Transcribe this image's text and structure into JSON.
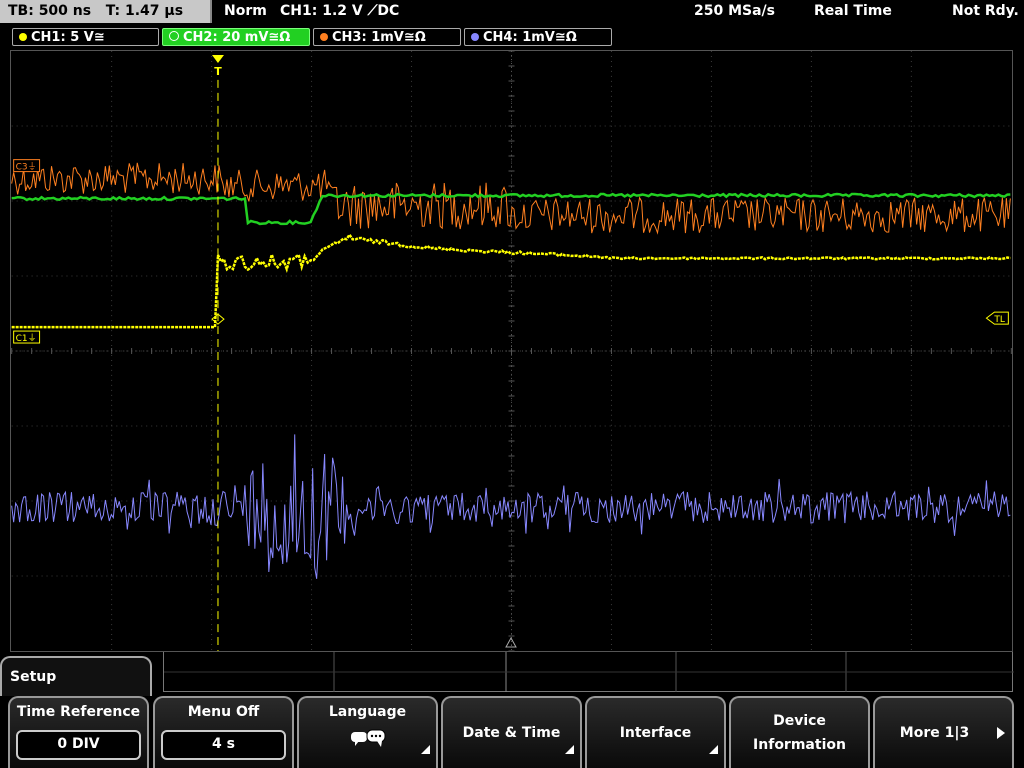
{
  "status": {
    "timebase": "TB: 500 ns",
    "trigger_time": "T: 1.47 µs",
    "mode": "Norm",
    "trigger_info": "CH1: 1.2 V ⟋DC",
    "sample_rate": "250 MSa/s",
    "acq_mode": "Real Time",
    "state": "Not Rdy."
  },
  "channels": [
    {
      "label": "CH1: 5 V≅",
      "color": "#ffff00",
      "active": false
    },
    {
      "label": "CH2: 20 mV≅Ω",
      "color": "#22d022",
      "active": true
    },
    {
      "label": "CH3: 1mV≅Ω",
      "color": "#ff8020",
      "active": false
    },
    {
      "label": "CH4: 1mV≅Ω",
      "color": "#8888ff",
      "active": false
    }
  ],
  "markers": {
    "c3": "C3⏚",
    "c1": "C1⏚",
    "trigger_level": "TL",
    "trigger_pos": "T"
  },
  "menu": {
    "title": "Setup",
    "softkeys": [
      {
        "label": "Time Reference",
        "value": "0 DIV"
      },
      {
        "label": "Menu Off",
        "value": "4 s"
      },
      {
        "label": "Language",
        "icon": "speech-bubbles-icon"
      },
      {
        "label": "Date & Time"
      },
      {
        "label": "Interface"
      },
      {
        "label": "Device",
        "label2": "Information"
      },
      {
        "label": "More 1|3"
      }
    ]
  }
}
